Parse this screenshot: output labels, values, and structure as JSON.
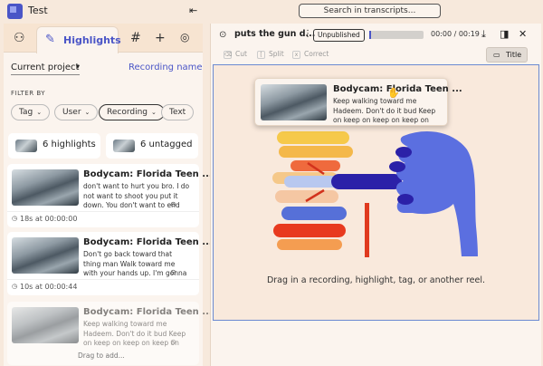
{
  "app": {
    "title": "Test",
    "search_placeholder": "Search in transcripts..."
  },
  "left": {
    "tabs": [
      {
        "name": "tab-people",
        "icon": "people-icon"
      },
      {
        "name": "tab-highlights",
        "label": "Highlights",
        "icon": "highlighter-icon",
        "active": true
      },
      {
        "name": "tab-tags",
        "icon": "hash-icon"
      },
      {
        "name": "tab-add",
        "icon": "plus-icon"
      },
      {
        "name": "tab-chat",
        "icon": "chat-icon"
      }
    ],
    "scope": "Current project",
    "sort": "Recording name",
    "filter_label": "FILTER BY",
    "filters": [
      "Tag",
      "User",
      "Recording",
      "Text"
    ],
    "active_filter": "Recording",
    "counts": {
      "highlights": "6 highlights",
      "untagged": "6 untagged"
    },
    "cards": [
      {
        "title": "Bodycam:  Florida Teen ...",
        "text": "don't want to hurt you bro. I do not want to shoot you put it down. You don't want to end up...",
        "meta": "18s at 00:00:00"
      },
      {
        "title": "Bodycam:  Florida Teen ...",
        "text": "Don't go back toward that thing man Walk toward me with your hands up. I'm gonna walk you...",
        "meta": "10s at 00:00:44"
      },
      {
        "title": "Bodycam:  Florida Teen ...",
        "text": "Keep walking toward me Hadeem. Don't do it bud Keep on keep on keep on keep on keep continuing...",
        "meta": ""
      }
    ],
    "drag_hint": "Drag to add..."
  },
  "reel": {
    "title": "puts the gun d...",
    "status": "Unpublished",
    "progress": 0.02,
    "timecode": "00:00 / 00:19",
    "tools": [
      {
        "key": "⌫",
        "label": "Cut"
      },
      {
        "key": "[",
        "label": "Split"
      },
      {
        "key": "x",
        "label": "Correct"
      }
    ],
    "title_button": "Title",
    "drop_text": "Drag in a recording, highlight, tag, or another reel."
  },
  "drag_preview": {
    "title": "Bodycam:  Florida Teen ...",
    "text": "Keep walking toward me Hadeem. Don't do it bud Keep on keep on keep on keep on keep continuing..."
  },
  "colors": {
    "accent": "#4a55c7",
    "background": "#f7e9dc",
    "panel": "#fbf4ee",
    "drop_border": "#6b8ad1"
  }
}
